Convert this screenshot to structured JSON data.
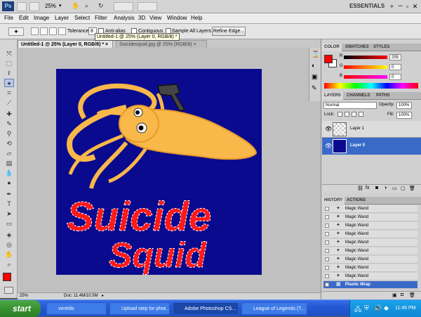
{
  "titlebar": {
    "zoom": "25%",
    "workspace": "ESSENTIALS",
    "search_placeholder": ""
  },
  "menu": [
    "File",
    "Edit",
    "Image",
    "Layer",
    "Select",
    "Filter",
    "Analysis",
    "3D",
    "View",
    "Window",
    "Help"
  ],
  "options": {
    "tolerance_label": "Tolerance:",
    "tolerance_value": "8",
    "antialias": "Anti-alias",
    "contiguous": "Contiguous",
    "sample_all": "Sample All Layers",
    "refine_edge": "Refine Edge...",
    "tooltip": "Untitled-1 @ 25% (Layer 0, RGB/8) *"
  },
  "doc_tabs": [
    {
      "label": "Untitled-1 @ 25% (Layer 0, RGB/8) *",
      "active": true
    },
    {
      "label": "Suicidesquid.jpg @ 25% (RGB/8)",
      "active": false
    }
  ],
  "artwork": {
    "text_line1": "Suicide",
    "text_line2": "Squid",
    "colors": {
      "bg": "#0a0a8f",
      "squid": "#f8b84a",
      "text": "#ff1a1a"
    }
  },
  "status": {
    "zoom": "25%",
    "doc": "Doc: 11.4M/10.5M"
  },
  "color_panel": {
    "tabs": [
      "COLOR",
      "SWATCHES",
      "STYLES"
    ],
    "r": "255",
    "g": "0",
    "b": "0",
    "foreground": "#ff0000"
  },
  "layers_panel": {
    "tabs": [
      "LAYERS",
      "CHANNELS",
      "PATHS"
    ],
    "blend_mode": "Normal",
    "opacity_label": "Opacity:",
    "opacity": "100%",
    "lock_label": "Lock:",
    "fill_label": "Fill:",
    "fill": "100%",
    "layers": [
      {
        "name": "Layer 1",
        "selected": false
      },
      {
        "name": "Layer 0",
        "selected": true
      }
    ]
  },
  "history_panel": {
    "tabs": [
      "HISTORY",
      "ACTIONS"
    ],
    "items": [
      "Magic Wand",
      "Magic Wand",
      "Magic Wand",
      "Magic Wand",
      "Magic Wand",
      "Magic Wand",
      "Magic Wand",
      "Magic Wand",
      "Magic Wand",
      "Magic Wand"
    ],
    "last": "Plastic Wrap"
  },
  "taskbar": {
    "start": "start",
    "tasks": [
      {
        "label": "ventrilo",
        "active": false
      },
      {
        "label": "Upload step for phot...",
        "active": false
      },
      {
        "label": "Adobe Photoshop CS...",
        "active": true
      },
      {
        "label": "League of Legends (T...",
        "active": false
      }
    ],
    "time": "11:46 PM"
  }
}
